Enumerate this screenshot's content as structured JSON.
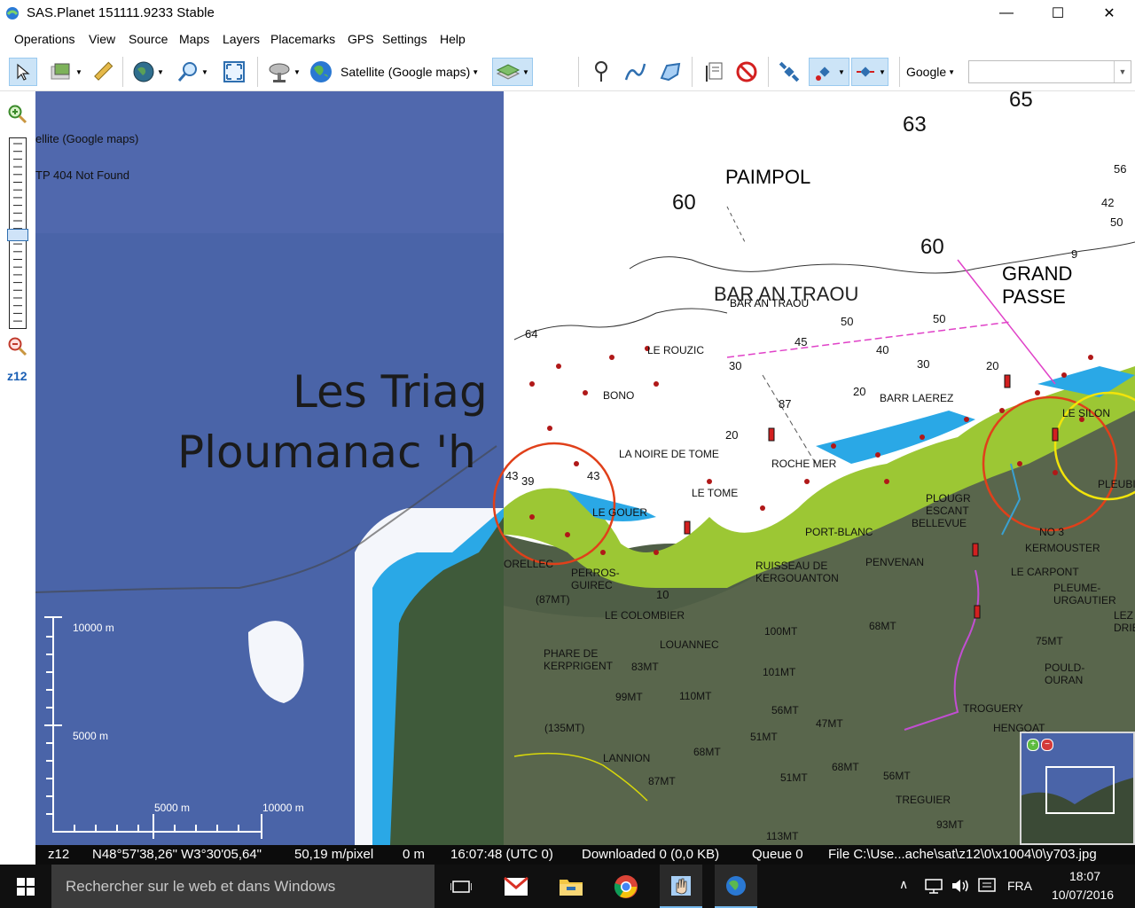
{
  "window": {
    "title": "SAS.Planet 151111.9233 Stable",
    "minimize": "—",
    "maximize": "☐",
    "close": "✕"
  },
  "menu": [
    "Operations",
    "View",
    "Source",
    "Maps",
    "Layers",
    "Placemarks",
    "GPS",
    "Settings",
    "Help"
  ],
  "toolbar": {
    "map_source_label": "Satellite (Google maps)",
    "search_provider": "Google",
    "search_value": ""
  },
  "left_panel": {
    "zoom_level": "z12"
  },
  "map": {
    "overlay_map_name": "ellite (Google maps)",
    "overlay_error": "TP 404 Not Found",
    "place_label_1": "Les Triag",
    "place_label_2": "Ploumanac 'h",
    "scale_vertical_top": "10000 m",
    "scale_vertical_mid": "5000 m",
    "scale_horizontal_1": "5000 m",
    "scale_horizontal_2": "10000 m",
    "chart_labels": {
      "paimpol": "PAIMPOL",
      "bar_an_traou": "BAR AN TRAOU",
      "le_rouzic": "LE ROUZIC",
      "bono": "BONO",
      "la_noire_de_tome": "LA NOIRE DE TOME",
      "le_tome": "LE TOME",
      "barr_laerez": "BARR LAEREZ",
      "grand_passe": "GRAND PASSE",
      "port_blanc": "PORT-BLANC",
      "plougr_escant": "PLOUGR ESCANT",
      "bellevue": "BELLEVUE",
      "no3": "NO 3",
      "kermouster": "KERMOUSTER",
      "le_carpont": "LE CARPONT",
      "pleume_urgautier": "PLEUME- URGAUTIER",
      "pleubian": "PLEUBIAN",
      "perros_guirec": "PERROS- GUIREC",
      "perros_alt": "(87MT)",
      "rellec": "ORELLEC",
      "le_colombier": "LE COLOMBIER",
      "ruisseau": "RUISSEAU DE KERGOUANTON",
      "penvenan": "PENVENAN",
      "louannec": "LOUANNEC",
      "phare": "PHARE DE KERPRIGENT",
      "lannion": "LANNION",
      "trogury": "TROGUERY",
      "hengoat": "HENGOAT",
      "pouldouran": "POULD- OURAN",
      "treguier": "TREGUIER",
      "lez_drien": "LEZ DRIE",
      "le_gouer": "LE GOUER",
      "le_silon": "LE SILON",
      "ile_marquer": "ROCHE MER"
    },
    "heights": [
      "100MT",
      "68MT",
      "101MT",
      "75MT",
      "83MT",
      "99MT",
      "110MT",
      "56MT",
      "47MT",
      "51MT",
      "68MT",
      "68MT",
      "56MT",
      "51MT",
      "87MT",
      "(135MT)",
      "113MT",
      "93MT"
    ],
    "depths": [
      "65",
      "63",
      "60",
      "60",
      "56",
      "42",
      "50",
      "9",
      "64",
      "50",
      "45",
      "40",
      "30",
      "20",
      "30",
      "50",
      "20",
      "87",
      "20",
      "43",
      "39",
      "43",
      "10"
    ]
  },
  "status": {
    "zoom": "z12",
    "coords": "N48°57'38,26\" W3°30'05,64\"",
    "resolution": "50,19 m/pixel",
    "distance": "0 m",
    "time": "16:07:48 (UTC 0)",
    "downloaded": "Downloaded 0 (0,0 KB)",
    "queue": "Queue 0",
    "file": "File C:\\Use...ache\\sat\\z12\\0\\x1004\\0\\y703.jpg"
  },
  "taskbar": {
    "search_placeholder": "Rechercher sur le web et dans Windows",
    "language": "FRA",
    "time": "18:07",
    "date": "10/07/2016"
  }
}
